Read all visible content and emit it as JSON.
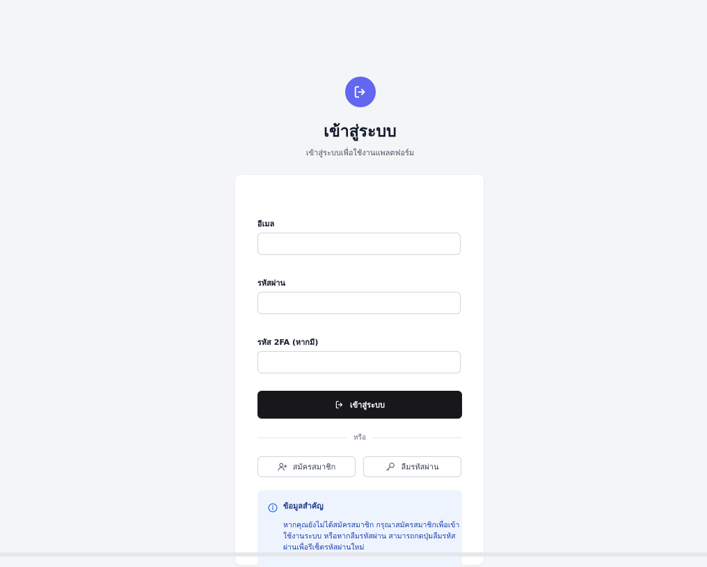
{
  "header": {
    "icon": "login-icon",
    "title": "เข้าสู่ระบบ",
    "subtitle": "เข้าสู่ระบบเพื่อใช้งานแพลตฟอร์ม",
    "accent_color": "#6366f1"
  },
  "form": {
    "email_label": "อีเมล",
    "email_value": "",
    "password_label": "รหัสผ่าน",
    "password_value": "",
    "twofa_label": "รหัส 2FA (หากมี)",
    "twofa_value": "",
    "submit_label": "เข้าสู่ระบบ",
    "submit_icon": "login-icon",
    "divider_label": "หรือ"
  },
  "secondary_actions": {
    "register_label": "สมัครสมาชิก",
    "register_icon": "user-plus-icon",
    "forgot_label": "ลืมรหัสผ่าน",
    "forgot_icon": "key-icon"
  },
  "info": {
    "icon": "info-icon",
    "title": "ข้อมูลสำคัญ",
    "text": "หากคุณยังไม่ได้สมัครสมาชิก กรุณาสมัครสมาชิกเพื่อเข้าใช้งานระบบ หรือหากลืมรหัสผ่าน สามารถกดปุ่มลืมรหัสผ่านเพื่อรีเซ็ตรหัสผ่านใหม่"
  }
}
